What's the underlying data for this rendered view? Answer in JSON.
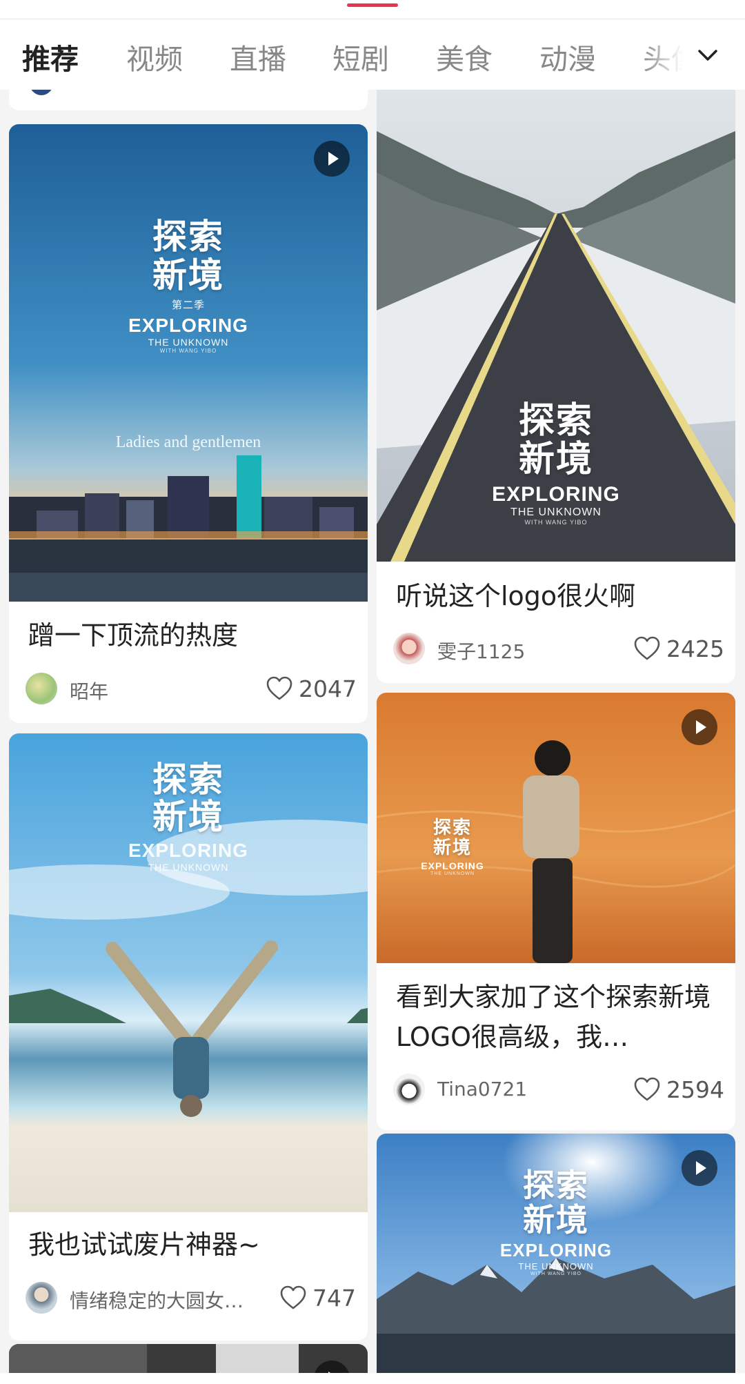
{
  "tabs": [
    "推荐",
    "视频",
    "直播",
    "短剧",
    "美食",
    "动漫",
    "头像"
  ],
  "overlay": {
    "cn_line1": "探索",
    "cn_line2": "新境",
    "en_title": "EXPLORING",
    "en_sub": "THE UNKNOWN",
    "en_tiny": "WITH WANG YIBO",
    "season": "第二季",
    "caption": "Ladies and gentlemen"
  },
  "cards": [
    {
      "title": "蹭一下顶流的热度",
      "author": "昭年",
      "likes": "2047",
      "video": true
    },
    {
      "title": "听说这个logo很火啊",
      "author": "雯子1125",
      "likes": "2425",
      "video": false
    },
    {
      "title": "我也试试废片神器~",
      "author": "情绪稳定的大圆女…",
      "likes": "747",
      "video": false
    },
    {
      "title": "看到大家加了这个探索新境LOGO很高级，我…",
      "author": "Tina0721",
      "likes": "2594",
      "video": true
    },
    {
      "title": "",
      "author": "",
      "likes": "",
      "video": true
    }
  ],
  "colors": {
    "accent": "#e8344e",
    "background": "#f4f4f4"
  }
}
